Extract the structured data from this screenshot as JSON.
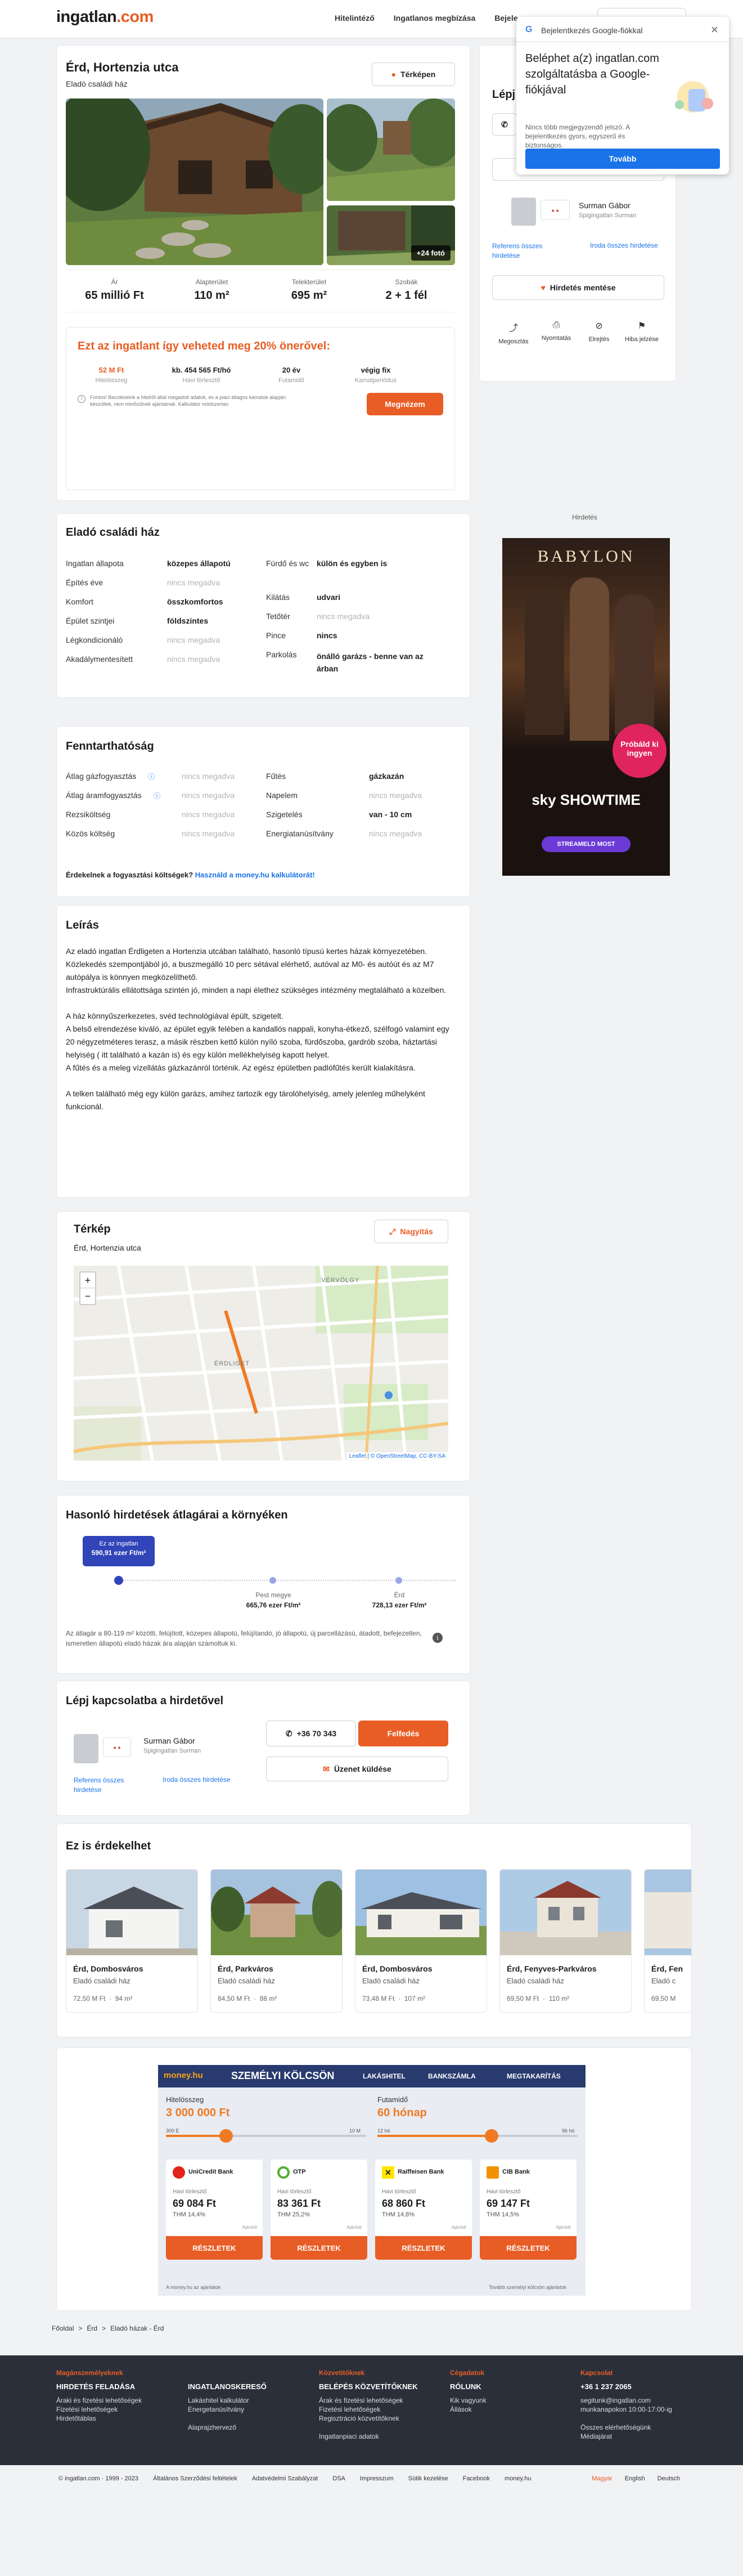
{
  "header": {
    "logo_a": "ingatlan",
    "logo_b": ".com",
    "nav": [
      "Hitelintéző",
      "Ingatlanos megbízása",
      "Bejele"
    ]
  },
  "google_popup": {
    "title": "Bejelentkezés Google-fiókkal",
    "heading": "Beléphet a(z) ingatlan.com szolgáltatásba a Google-fiókjával",
    "body": "Nincs több megjegyzendő jelszó. A bejelentkezés gyors, egyszerű és biztonságos.",
    "button": "Tovább"
  },
  "listing": {
    "title": "Érd, Hortenzia utca",
    "subtitle": "Eladó családi ház",
    "map_button": "Térképen",
    "photo_count": "+24 fotó",
    "stats": [
      {
        "label": "Ár",
        "value": "65 millió Ft"
      },
      {
        "label": "Alapterület",
        "value": "110 m²"
      },
      {
        "label": "Telekterület",
        "value": "695 m²"
      },
      {
        "label": "Szobák",
        "value": "2 + 1 fél"
      }
    ],
    "loan_heading": "Ezt az ingatlant így veheted meg 20% önerővel:",
    "loan": [
      {
        "value": "52 M Ft",
        "label": "Hitelösszeg"
      },
      {
        "value": "kb. 454 565 Ft/hó",
        "label": "Havi törlesztő"
      },
      {
        "value": "20 év",
        "label": "Futamidő"
      },
      {
        "value": "végig fix",
        "label": "Kamatperiódus"
      }
    ],
    "loan_note": "Fontos! Becsléseink a hitelről által megadott adatok, és a piaci átlagos kamatok alapján készültek, nem minősülnek ajánlatnak. Kalkulátor módszertan",
    "loan_button": "Megnézem"
  },
  "agent": {
    "label": "Lépj",
    "name": "Surman Gábor",
    "company": "Spigingatlan Surman",
    "ref_link": "Referens összes hirdetése",
    "office_link": "Iroda összes hirdetése",
    "save_button": "Hirdetés mentése",
    "actions": [
      "Megosztás",
      "Nyomtatás",
      "Elrejtés",
      "Hiba jelzése"
    ]
  },
  "ad": {
    "label": "Hirdetés",
    "title": "BABYLON",
    "cta": "Próbáld ki ingyen",
    "brand": "sky SHOWTIME",
    "btn": "STREAMELD MOST"
  },
  "details": {
    "heading": "Eladó családi ház",
    "left": [
      {
        "label": "Ingatlan állapota",
        "value": "közepes állapotú",
        "nv": false
      },
      {
        "label": "Építés éve",
        "value": "nincs megadva",
        "nv": true
      },
      {
        "label": "Komfort",
        "value": "összkomfortos",
        "nv": false
      },
      {
        "label": "Épület szintjei",
        "value": "földszintes",
        "nv": false
      },
      {
        "label": "Légkondicionáló",
        "value": "nincs megadva",
        "nv": true
      },
      {
        "label": "Akadálymentesített",
        "value": "nincs megadva",
        "nv": true
      }
    ],
    "right": [
      {
        "label": "Fürdő és wc",
        "value": "külön és egyben is",
        "nv": false
      },
      {
        "label": "Kilátás",
        "value": "udvari",
        "nv": false
      },
      {
        "label": "Tetőtér",
        "value": "nincs megadva",
        "nv": true
      },
      {
        "label": "Pince",
        "value": "nincs",
        "nv": false
      },
      {
        "label": "Parkolás",
        "value": "önálló garázs - benne van az árban",
        "nv": false
      }
    ]
  },
  "sustain": {
    "heading": "Fenntarthatóság",
    "left": [
      {
        "label": "Átlag gázfogyasztás",
        "value": "nincs megadva"
      },
      {
        "label": "Átlag áramfogyasztás",
        "value": "nincs megadva"
      },
      {
        "label": "Rezsiköltség",
        "value": "nincs megadva"
      },
      {
        "label": "Közös költség",
        "value": "nincs megadva"
      }
    ],
    "right": [
      {
        "label": "Fűtés",
        "value": "gázkazán",
        "nv": false
      },
      {
        "label": "Napelem",
        "value": "nincs megadva",
        "nv": true
      },
      {
        "label": "Szigetelés",
        "value": "van - 10 cm",
        "nv": false
      },
      {
        "label": "Energiatanúsítvány",
        "value": "nincs megadva",
        "nv": true
      }
    ],
    "question": "Érdekelnek a fogyasztási költségek?",
    "question_link": "Használd a money.hu kalkulátorát!"
  },
  "description": {
    "heading": "Leírás",
    "p1": [
      "Az eladó ingatlan Érdligeten a Hortenzia utcában található, hasonló típusú kertes házak környezetében.",
      "Közlekedés szempontjából jó, a buszmegálló 10 perc sétával elérhető, autóval az M0- és autóút és az M7 autópálya is könnyen megközelíthető.",
      "Infrastruktúrális ellátottsága szintén jó, minden a napi élethez szükséges intézmény megtalálható a közelben."
    ],
    "p2": [
      "A ház könnyűszerkezetes, svéd technológiával épült, szigetelt.",
      "A belső elrendezése kiváló, az épület egyik felében a kandallós nappali, konyha-étkező, szélfogó valamint egy 20 négyzetméteres terasz, a másik részben kettő külön nyíló szoba, fürdőszoba, gardrób szoba, háztartási helyiség ( itt található a kazán is) és egy külön mellékhelyiség kapott helyet.",
      "A fűtés és a meleg vízellátás gázkazánról történik. Az egész épületben padlófűtés került kialakításra."
    ],
    "p3": [
      "A telken található még egy külön garázs, amihez tartozik egy tárolóhelyiség, amely jelenleg műhelyként funkcionál."
    ]
  },
  "map": {
    "heading": "Térkép",
    "subtitle": "Érd, Hortenzia utca",
    "zoom_button": "Nagyítás",
    "attribution": "Leaflet | © OpenStreetMap, CC-BY-SA",
    "labels": [
      "ÉRDLIGET",
      "VÉRVÖLGY"
    ]
  },
  "prices": {
    "heading": "Hasonló hirdetések átlagárai a környéken",
    "bubble_l1": "Ez az ingatlan",
    "bubble_l2": "590,91 ezer Ft/m²",
    "points": [
      {
        "label": "Pest megye",
        "value": "665,76 ezer Ft/m²"
      },
      {
        "label": "Érd",
        "value": "728,13 ezer Ft/m²"
      }
    ],
    "note": "Az átlagár a 80-119 m² közötti, felújított, közepes állapotú, felújítandó, jó állapotú, új parcellázású, átadott, befejezetlen, ismeretlen állapotú eladó házak ára alapján számoltuk ki."
  },
  "contact": {
    "heading": "Lépj kapcsolatba a hirdetővel",
    "name": "Surman Gábor",
    "company": "Spigingatlan Surman",
    "ref_link": "Referens összes hirdetése",
    "office_link": "Iroda összes hirdetése",
    "phone": "+36 70 343",
    "reveal": "Felfedés",
    "message": "Üzenet küldése"
  },
  "similar": {
    "heading": "Ez is érdekelhet",
    "items": [
      {
        "loc": "Érd, Dombosváros",
        "type": "Eladó családi ház",
        "price": "72,50 M Ft",
        "area": "94 m²"
      },
      {
        "loc": "Érd, Parkváros",
        "type": "Eladó családi ház",
        "price": "84,50 M Ft",
        "area": "88 m²"
      },
      {
        "loc": "Érd, Dombosváros",
        "type": "Eladó családi ház",
        "price": "73,48 M Ft",
        "area": "107 m²"
      },
      {
        "loc": "Érd, Fenyves-Parkváros",
        "type": "Eladó családi ház",
        "price": "69,50 M Ft",
        "area": "110 m²"
      },
      {
        "loc": "Érd, Fen",
        "type": "Eladó c",
        "price": "69,50 M",
        "area": ""
      }
    ]
  },
  "money": {
    "logo": "money.hu",
    "title": "SZEMÉLYI KÖLCSÖN",
    "tabs": [
      "LAKÁSHITEL",
      "BANKSZÁMLA",
      "MEGTAKARÍTÁS"
    ],
    "amount_label": "Hitelösszeg",
    "amount": "3 000 000 Ft",
    "term_label": "Futamidő",
    "term": "60 hónap",
    "min_amount": "300 E",
    "max_amount": "10 M",
    "min_term": "12 hó",
    "max_term": "96 hó",
    "monthly_label": "Havi törlesztő",
    "button": "RÉSZLETEK",
    "sponsor": "Ajánlott",
    "footer_l": "A money.hu az ajánlatok",
    "footer_r": "Tovább személyi kölcsön ajánlatok",
    "banks": [
      {
        "name": "UniCredit Bank",
        "monthly": "69 084 Ft",
        "thm": "THM 14,4%"
      },
      {
        "name": "OTP",
        "monthly": "83 361 Ft",
        "thm": "THM 25,2%"
      },
      {
        "name": "Raiffeisen Bank",
        "monthly": "68 860 Ft",
        "thm": "THM 14,8%"
      },
      {
        "name": "CIB Bank",
        "monthly": "69 147 Ft",
        "thm": "THM 14,5%"
      }
    ]
  },
  "breadcrumb": [
    "Főoldal",
    ">",
    "Érd",
    ">",
    "Eladó házak - Érd"
  ],
  "footer": {
    "cols": [
      {
        "title": "Magánszemélyeknek",
        "sub": "HIRDETÉS FELADÁSA",
        "links": [
          "Áraki és fizetési lehetőségek",
          "Fizetési lehetőségek",
          "Hirdetőtáblas"
        ]
      },
      {
        "title": "",
        "sub": "INGATLANOSKERESŐ",
        "links": [
          "Lakáshitel kalkulátor",
          "Energetanúsítvány",
          "",
          "Alaprajzhervező"
        ]
      },
      {
        "title": "Közvetítőknek",
        "sub": "BELÉPÉS KÖZVETÍTŐKNEK",
        "links": [
          "Árak és fizetési lehetőségek",
          "Fizetési lehetőségek",
          "Regisztráció közvetítőknek",
          "",
          "Ingatlanpiaci adatok"
        ]
      },
      {
        "title": "Cégadatok",
        "sub": "RÓLUNK",
        "links": [
          "Kik vagyunk",
          "Állások"
        ]
      },
      {
        "title": "Kapcsolat",
        "sub": "+36 1 237 2065",
        "links": [
          "segitunk@ingatlan.com",
          "munkanapokon 10:00-17:00-ig",
          "",
          "Összes elérhetőségünk",
          "Médiajárat"
        ]
      }
    ],
    "bottom": [
      "© ingatlan.com · 1999 - 2023",
      "Általános Szerződési feltételek",
      "Adatvédelmi Szabályzat",
      "DSA",
      "Impresszum",
      "Sütik kezelése",
      "Facebook",
      "money.hu"
    ],
    "langs": [
      "Magyar",
      "English",
      "Deutsch"
    ]
  }
}
